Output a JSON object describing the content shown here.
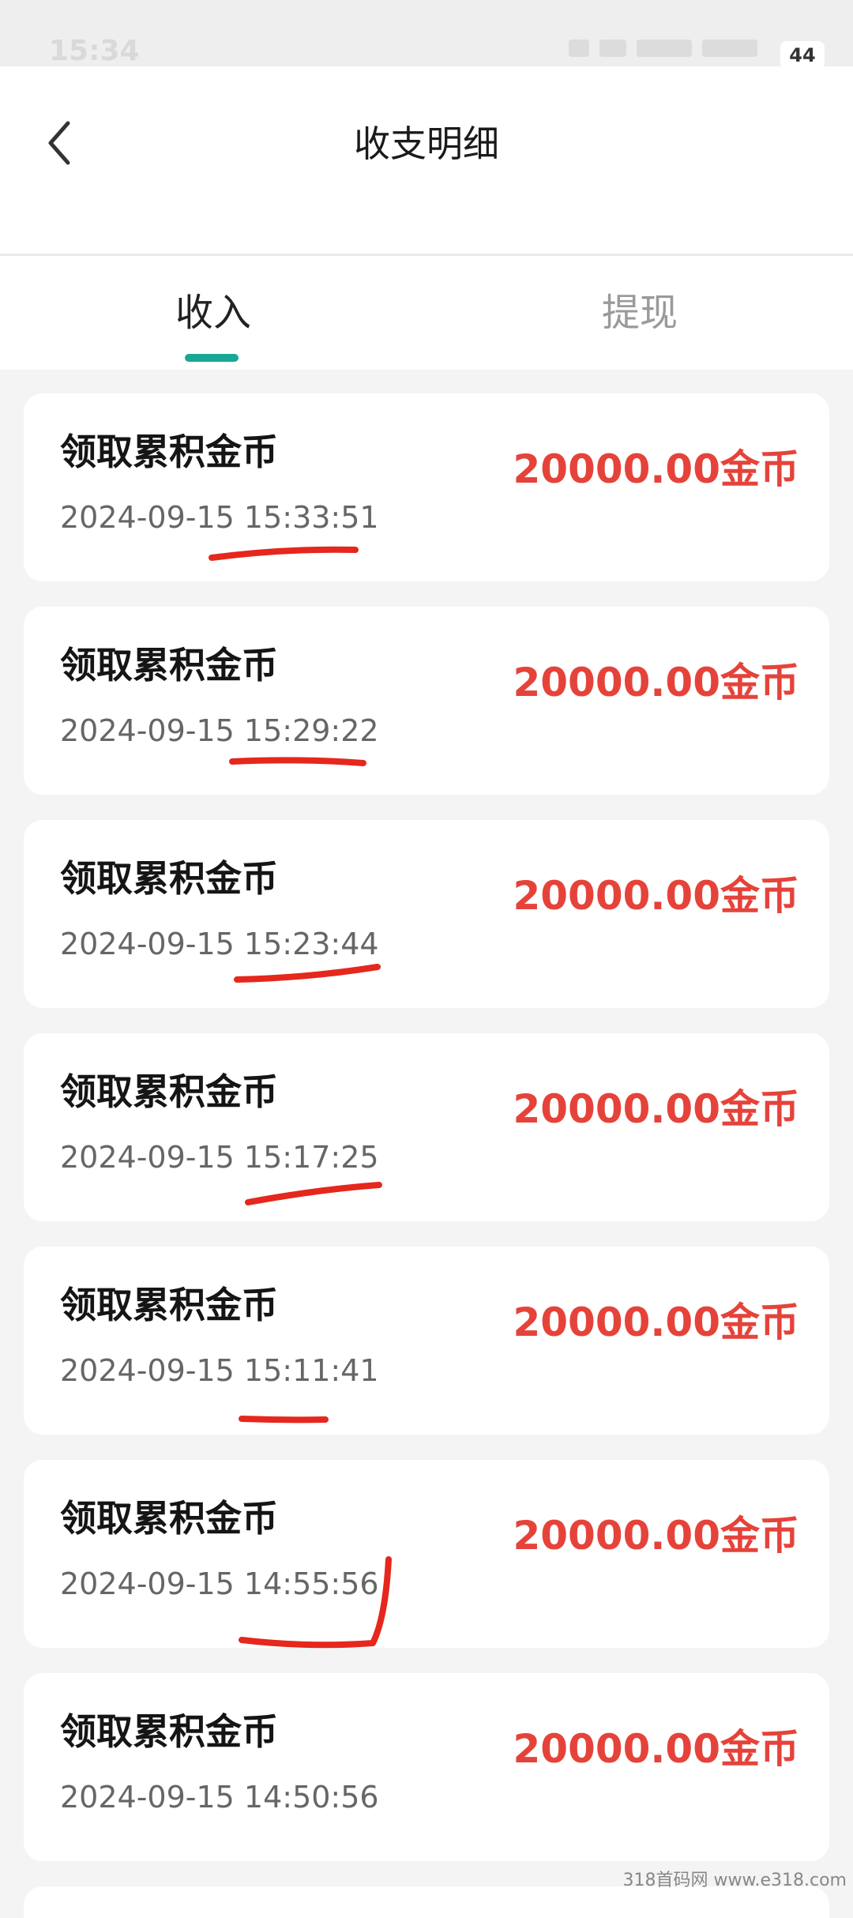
{
  "status_bar": {
    "time": "15:34",
    "battery": "44"
  },
  "nav": {
    "title": "收支明细"
  },
  "tabs": [
    {
      "label": "收入",
      "active": true
    },
    {
      "label": "提现",
      "active": false
    }
  ],
  "colors": {
    "accent": "#19a896",
    "amount": "#e5433a",
    "annotation": "#e5271d"
  },
  "records": [
    {
      "title": "领取累积金币",
      "date": "2024-09-15 15:33:51",
      "amount": "20000.00金币"
    },
    {
      "title": "领取累积金币",
      "date": "2024-09-15 15:29:22",
      "amount": "20000.00金币"
    },
    {
      "title": "领取累积金币",
      "date": "2024-09-15 15:23:44",
      "amount": "20000.00金币"
    },
    {
      "title": "领取累积金币",
      "date": "2024-09-15 15:17:25",
      "amount": "20000.00金币"
    },
    {
      "title": "领取累积金币",
      "date": "2024-09-15 15:11:41",
      "amount": "20000.00金币"
    },
    {
      "title": "领取累积金币",
      "date": "2024-09-15 14:55:56",
      "amount": "20000.00金币"
    },
    {
      "title": "领取累积金币",
      "date": "2024-09-15 14:50:56",
      "amount": "20000.00金币"
    }
  ],
  "watermark": "318首码网 www.e318.com"
}
